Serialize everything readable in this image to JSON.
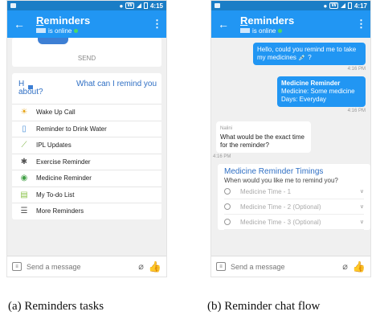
{
  "phone_a": {
    "status_time": "4:15",
    "app_title": "Reminders",
    "online_status": "is online",
    "send_label": "SEND",
    "task_heading": [
      "H",
      "What can I remind you",
      "about?"
    ],
    "tasks": [
      {
        "label": "Wake Up Call",
        "icon": "sunrise-icon"
      },
      {
        "label": "Reminder to Drink Water",
        "icon": "water-glass-icon"
      },
      {
        "label": "IPL Updates",
        "icon": "cricket-bat-icon"
      },
      {
        "label": "Exercise Reminder",
        "icon": "exercise-icon"
      },
      {
        "label": "Medicine Reminder",
        "icon": "pills-icon"
      },
      {
        "label": "My To-do List",
        "icon": "todo-list-icon"
      },
      {
        "label": "More Reminders",
        "icon": "list-icon"
      }
    ],
    "input_placeholder": "Send a message"
  },
  "phone_b": {
    "status_time": "4:17",
    "app_title": "Reminders",
    "online_status": "is online",
    "user_message": "Hello, could you remind me to take my medicines 💉 ?",
    "user_time": "4:16 PM",
    "reminder_title": "Medicine Reminder",
    "reminder_lines": [
      "Medicine: Some medicine",
      "Days: Everyday"
    ],
    "reminder_time": "4:16 PM",
    "bot_sender": "Nalini",
    "bot_message": "What would be the exact time for the reminder?",
    "bot_time": "4:16 PM",
    "timing_title": "Medicine Reminder Timings",
    "timing_subtitle": "When would you like me to remind you?",
    "time_options": [
      "Medicine Time - 1",
      "Medicine Time - 2 (Optional)",
      "Medicine Time - 3 (Optional)"
    ],
    "input_placeholder": "Send a message"
  },
  "captions": {
    "a": "(a) Reminders tasks",
    "b": "(b) Reminder chat flow"
  },
  "colors": {
    "status_bar": "#1a7dc6",
    "app_bar": "#2196f3",
    "accent_text": "#2f6fc4",
    "like_blue": "#1a73d8"
  }
}
